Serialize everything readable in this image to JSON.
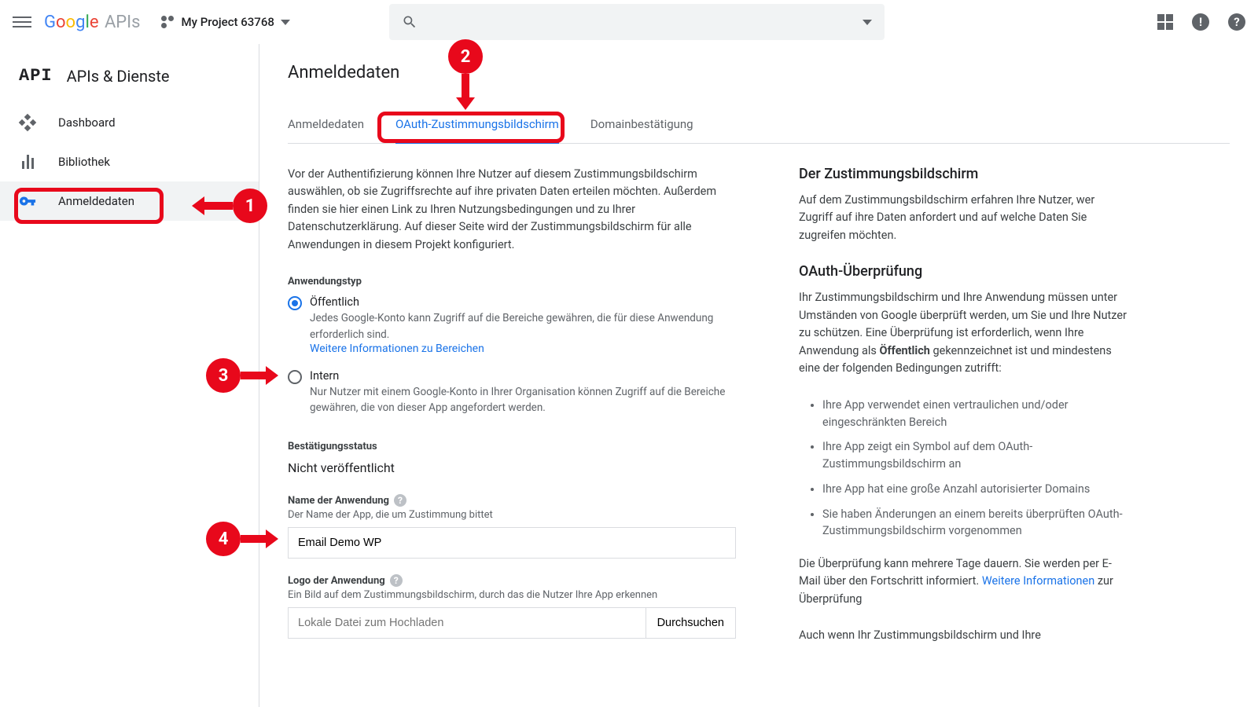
{
  "header": {
    "project_name": "My Project 63768"
  },
  "sidebar": {
    "api_label": "API",
    "title": "APIs & Dienste",
    "items": [
      {
        "label": "Dashboard"
      },
      {
        "label": "Bibliothek"
      },
      {
        "label": "Anmeldedaten"
      }
    ]
  },
  "page": {
    "title": "Anmeldedaten",
    "tabs": [
      {
        "label": "Anmeldedaten"
      },
      {
        "label": "OAuth-Zustimmungsbildschirm"
      },
      {
        "label": "Domainbestätigung"
      }
    ],
    "intro": "Vor der Authentifizierung können Ihre Nutzer auf diesem Zustimmungsbildschirm auswählen, ob sie Zugriffsrechte auf ihre privaten Daten erteilen möchten. Außerdem finden sie hier einen Link zu Ihren Nutzungsbedingungen und zu Ihrer Datenschutzerklärung. Auf dieser Seite wird der Zustimmungsbildschirm für alle Anwendungen in diesem Projekt konfiguriert.",
    "apptype": {
      "section": "Anwendungstyp",
      "public_label": "Öffentlich",
      "public_desc": "Jedes Google-Konto kann Zugriff auf die Bereiche gewähren, die für diese Anwendung erforderlich sind.",
      "public_link": "Weitere Informationen zu Bereichen",
      "internal_label": "Intern",
      "internal_desc": "Nur Nutzer mit einem Google-Konto in Ihrer Organisation können Zugriff auf die Bereiche gewähren, die von dieser App angefordert werden."
    },
    "status": {
      "section": "Bestätigungsstatus",
      "value": "Nicht veröffentlicht"
    },
    "appname": {
      "label": "Name der Anwendung",
      "hint": "Der Name der App, die um Zustimmung bittet",
      "value": "Email Demo WP"
    },
    "applogo": {
      "label": "Logo der Anwendung",
      "hint": "Ein Bild auf dem Zustimmungsbildschirm, durch das die Nutzer Ihre App erkennen",
      "placeholder": "Lokale Datei zum Hochladen",
      "browse": "Durchsuchen"
    }
  },
  "aside": {
    "consent_title": "Der Zustimmungsbildschirm",
    "consent_body": "Auf dem Zustimmungsbildschirm erfahren Ihre Nutzer, wer Zugriff auf ihre Daten anfordert und auf welche Daten Sie zugreifen möchten.",
    "oauth_title": "OAuth-Überprüfung",
    "oauth_body1": "Ihr Zustimmungsbildschirm und Ihre Anwendung müssen unter Umständen von Google überprüft werden, um Sie und Ihre Nutzer zu schützen. Eine Überprüfung ist erforderlich, wenn Ihre Anwendung als ",
    "oauth_bold": "Öffentlich",
    "oauth_body2": " gekennzeichnet ist und mindestens eine der folgenden Bedingungen zutrifft:",
    "bullets": [
      "Ihre App verwendet einen vertraulichen und/oder eingeschränkten Bereich",
      "Ihre App zeigt ein Symbol auf dem OAuth-Zustimmungsbildschirm an",
      "Ihre App hat eine große Anzahl autorisierter Domains",
      "Sie haben Änderungen an einem bereits überprüften OAuth-Zustimmungsbildschirm vorgenommen"
    ],
    "review1": "Die Überprüfung kann mehrere Tage dauern. Sie werden per E-Mail über den Fortschritt informiert. ",
    "review_link": "Weitere Informationen",
    "review2": " zur Überprüfung",
    "tail": "Auch wenn Ihr Zustimmungsbildschirm und Ihre"
  },
  "annotations": {
    "n1": "1",
    "n2": "2",
    "n3": "3",
    "n4": "4"
  }
}
